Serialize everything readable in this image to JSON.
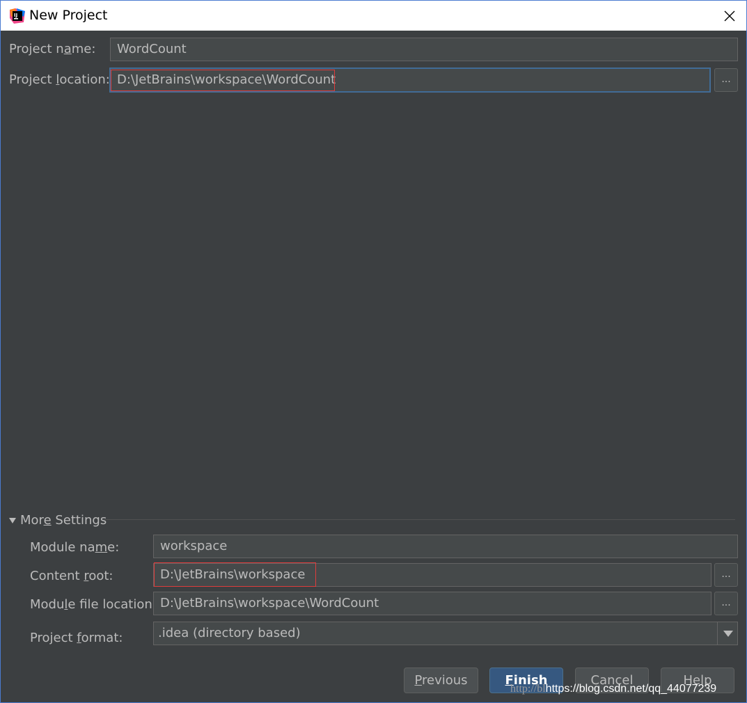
{
  "window": {
    "title": "New Project",
    "close_icon": "close-icon"
  },
  "form": {
    "project_name": {
      "label_pre": "Project n",
      "label_ul": "a",
      "label_post": "me:",
      "value": "WordCount"
    },
    "project_location": {
      "label_pre": "Project ",
      "label_ul": "l",
      "label_post": "ocation:",
      "value": "D:\\JetBrains\\workspace\\WordCount",
      "browse": "..."
    }
  },
  "more_settings": {
    "toggle_pre": "Mor",
    "toggle_ul": "e",
    "toggle_post": " Settings",
    "module_name": {
      "label_pre": "Module na",
      "label_ul": "m",
      "label_post": "e:",
      "value": "workspace"
    },
    "content_root": {
      "label_pre": "Content ",
      "label_ul": "r",
      "label_post": "oot:",
      "value": "D:\\JetBrains\\workspace",
      "browse": "..."
    },
    "module_file_location": {
      "label_pre": "Modu",
      "label_ul": "l",
      "label_post": "e file location:",
      "value": "D:\\JetBrains\\workspace\\WordCount",
      "browse": "..."
    },
    "project_format": {
      "label_pre": "Project ",
      "label_ul": "f",
      "label_post": "ormat:",
      "value": ".idea (directory based)"
    }
  },
  "buttons": {
    "previous": {
      "ul": "P",
      "rest": "revious"
    },
    "finish": {
      "ul": "F",
      "rest": "inish"
    },
    "cancel": "Cancel",
    "help": "Help"
  },
  "watermark": {
    "faint": "http://bl",
    "main": "https://blog.csdn.net/qq_44077239"
  },
  "colors": {
    "background": "#3c3f41",
    "field": "#45494a",
    "primary_button": "#365880",
    "highlight_box": "#e03c3c"
  }
}
